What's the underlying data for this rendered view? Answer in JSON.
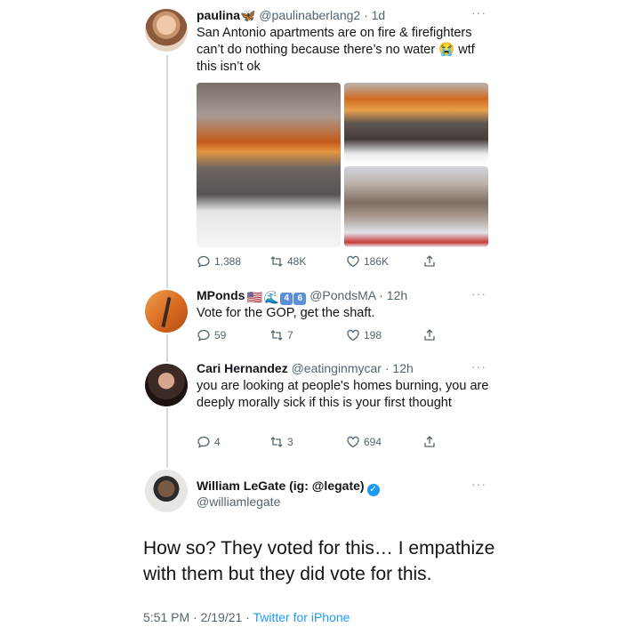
{
  "tweets": [
    {
      "name": "paulina",
      "name_emoji": "🦋",
      "handle": "@paulinaberlang2",
      "time": "· 1d",
      "text": "San Antonio apartments are on fire & firefighters can’t do nothing because there’s no water 😭 wtf this isn’t ok",
      "replies": "1,388",
      "retweets": "48K",
      "likes": "186K"
    },
    {
      "name": "MPonds",
      "flag_emoji": "🇺🇸",
      "wave_emoji": "🌊",
      "key1": "4",
      "key2": "6",
      "handle": "@PondsMA",
      "time": "· 12h",
      "text": "Vote for the GOP, get the shaft.",
      "replies": "59",
      "retweets": "7",
      "likes": "198"
    },
    {
      "name": "Cari Hernandez",
      "handle": "@eatinginmycar",
      "time": "· 12h",
      "text": "you are looking at people's homes burning, you are deeply morally sick if this is your first thought",
      "replies": "4",
      "retweets": "3",
      "likes": "694"
    }
  ],
  "main_tweet": {
    "name": "William LeGate (ig: @legate)",
    "handle": "@williamlegate",
    "text": "How so? They voted for this… I empathize with them but they did vote for this.",
    "timestamp": "5:51 PM · 2/19/21 · ",
    "source": "Twitter for iPhone"
  },
  "more_label": "···",
  "verified_glyph": "✓",
  "colors": {
    "accent": "#1d9bf0",
    "text": "#0f1419",
    "muted": "#536471",
    "line": "#cfd9de"
  }
}
